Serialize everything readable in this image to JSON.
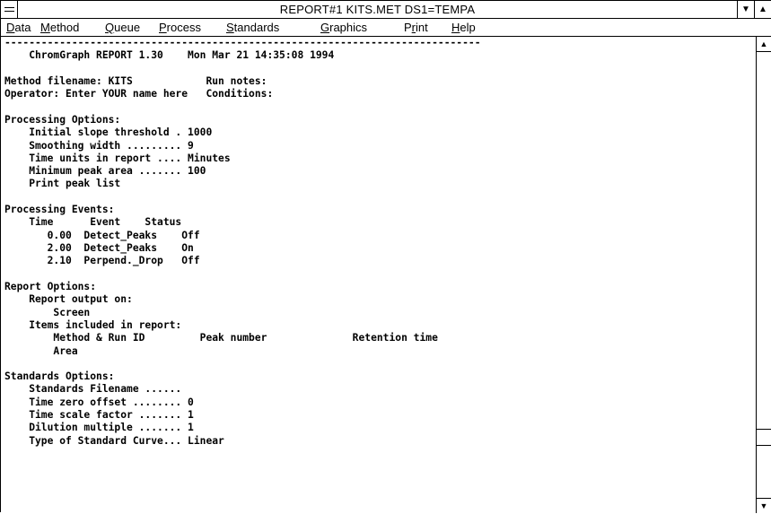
{
  "window": {
    "title": "REPORT#1  KITS.MET  DS1=TEMPA"
  },
  "titlebar": {
    "system_menu_icon": "system-menu-icon",
    "minimize_glyph": "▼",
    "maximize_glyph": "▲"
  },
  "menubar": {
    "items": [
      {
        "accel": "D",
        "rest": "ata"
      },
      {
        "accel": "M",
        "rest": "ethod"
      },
      {
        "accel": "Q",
        "rest": "ueue"
      },
      {
        "accel": "P",
        "rest": "rocess"
      },
      {
        "accel": "S",
        "rest": "tandards"
      },
      {
        "accel": "G",
        "rest": "raphics"
      },
      {
        "pre": "P",
        "accel": "r",
        "rest": "int"
      },
      {
        "accel": "H",
        "rest": "elp"
      }
    ]
  },
  "report": {
    "lines": [
      "------------------------------------------------------------------------------",
      "    ChromGraph REPORT 1.30    Mon Mar 21 14:35:08 1994",
      "",
      "Method filename: KITS            Run notes:",
      "Operator: Enter YOUR name here   Conditions:",
      "",
      "Processing Options:",
      "    Initial slope threshold . 1000",
      "    Smoothing width ......... 9",
      "    Time units in report .... Minutes",
      "    Minimum peak area ....... 100",
      "    Print peak list",
      "",
      "Processing Events:",
      "    Time      Event    Status",
      "       0.00  Detect_Peaks    Off",
      "       2.00  Detect_Peaks    On",
      "       2.10  Perpend._Drop   Off",
      "",
      "Report Options:",
      "    Report output on:",
      "        Screen",
      "    Items included in report:",
      "        Method & Run ID         Peak number              Retention time",
      "        Area",
      "",
      "Standards Options:",
      "    Standards Filename ......",
      "    Time zero offset ........ 0",
      "    Time scale factor ....... 1",
      "    Dilution multiple ....... 1",
      "    Type of Standard Curve... Linear"
    ]
  },
  "scrollbar": {
    "up_glyph": "▲",
    "down_glyph": "▼"
  }
}
